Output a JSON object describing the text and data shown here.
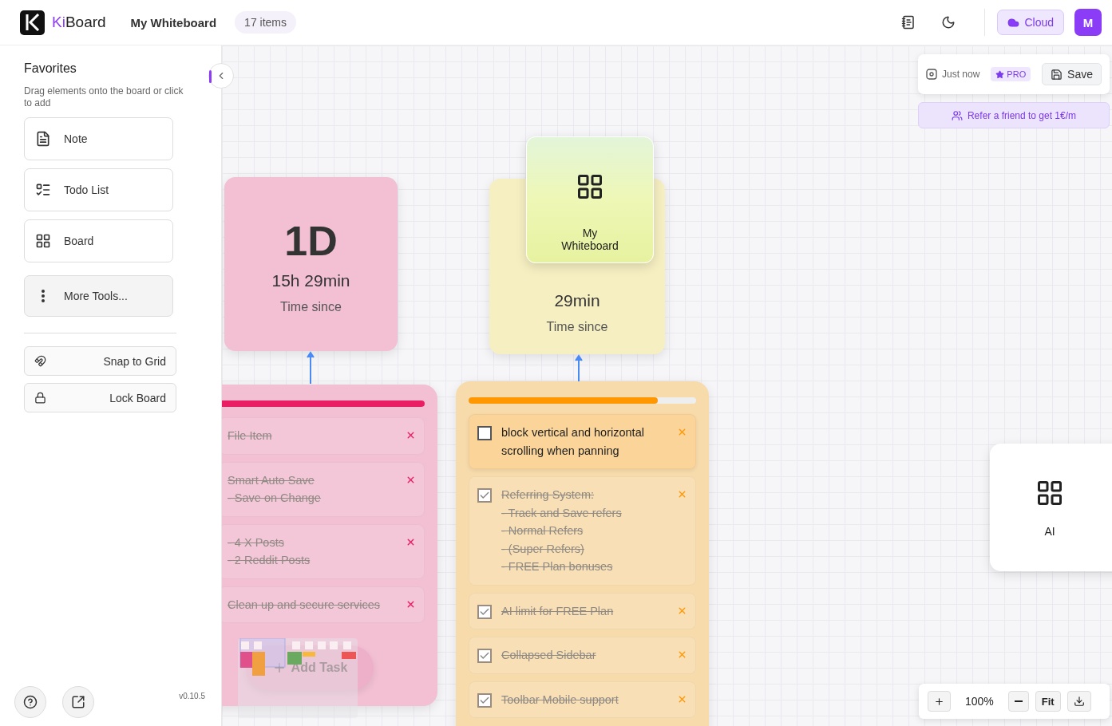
{
  "header": {
    "brand_accent": "Ki",
    "brand_rest": "Board",
    "board_title": "My Whiteboard",
    "item_count": "17 items",
    "cloud_button": "Cloud",
    "avatar": "M"
  },
  "sidebar": {
    "title": "Favorites",
    "hint": "Drag elements onto the board or click to add",
    "tools": [
      {
        "kind": "note",
        "label": "Note"
      },
      {
        "kind": "todo",
        "label": "Todo List"
      },
      {
        "kind": "board",
        "label": "Board"
      },
      {
        "kind": "more",
        "label": "More Tools..."
      }
    ],
    "toggles": [
      {
        "kind": "snap",
        "label": "Snap to Grid"
      },
      {
        "kind": "lock",
        "label": "Lock Board"
      }
    ],
    "version": "v0.10.5"
  },
  "canvas": {
    "timers": [
      {
        "days": "1D",
        "hours": "15h 29min",
        "caption": "Time since",
        "color": "#f2bfd3"
      },
      {
        "hours": "29min",
        "caption": "Time since",
        "color": "#f6efc2"
      }
    ],
    "board_card": {
      "title": "My Whiteboard"
    },
    "todo_lists": [
      {
        "kind": "pink",
        "level": 1,
        "checkboxes_visible": false,
        "add_task": "Add Task",
        "items": [
          {
            "lines": [
              "File Item"
            ],
            "checked": true
          },
          {
            "lines": [
              "Smart Auto Save",
              "- Save on Change"
            ],
            "checked": true
          },
          {
            "lines": [
              "- 4 X Posts",
              "- 2 Reddit Posts"
            ],
            "checked": true
          },
          {
            "lines": [
              "Clean up and secure services"
            ],
            "checked": true
          }
        ]
      },
      {
        "kind": "orange",
        "level": 0.83,
        "checkboxes_visible": true,
        "items": [
          {
            "lines": [
              "block vertical and horizontal",
              "scrolling when panning"
            ],
            "checked": false
          },
          {
            "lines": [
              "Referring System:",
              "- Track and Save refers",
              "- Normal Refers",
              "- (Super Refers)",
              "- FREE Plan bonuses"
            ],
            "checked": true
          },
          {
            "lines": [
              "AI limit for FREE Plan"
            ],
            "checked": true
          },
          {
            "lines": [
              "Collapsed Sidebar"
            ],
            "checked": true
          },
          {
            "lines": [
              "Toolbar Mobile support"
            ],
            "checked": true
          }
        ]
      }
    ],
    "ai_card": {
      "label": "AI"
    }
  },
  "save_panel": {
    "status": "Just now",
    "badge": "PRO",
    "save": "Save",
    "refer": "Refer a friend to get 1€/m"
  },
  "zoom": {
    "level_text": "100%",
    "fit": "Fit"
  }
}
